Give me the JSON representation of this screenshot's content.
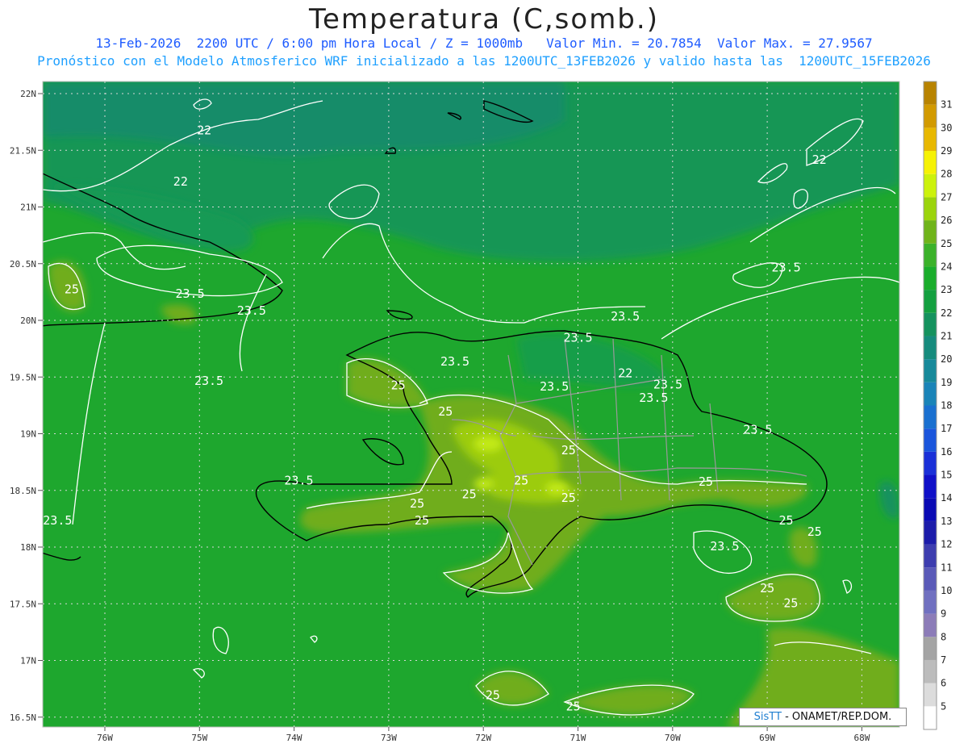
{
  "header": {
    "title": "Temperatura (C,somb.)",
    "line1": "13-Feb-2026  2200 UTC / 6:00 pm Hora Local / Z = 1000mb   Valor Min. = 20.7854  Valor Max. = 27.9567",
    "line2": "Pronóstico con el Modelo Atmosferico WRF inicializado a las 1200UTC_13FEB2026 y valido hasta las  1200UTC_15FEB2026"
  },
  "axes": {
    "lat_labels": [
      "22N",
      "21.5N",
      "21N",
      "20.5N",
      "20N",
      "19.5N",
      "19N",
      "18.5N",
      "18N",
      "17.5N",
      "17N",
      "16.5N"
    ],
    "lon_labels": [
      "76W",
      "75W",
      "74W",
      "73W",
      "72W",
      "71W",
      "70W",
      "69W",
      "68W"
    ]
  },
  "contour_labels": [
    {
      "text": "22",
      "lon": -74.95,
      "lat": 21.64
    },
    {
      "text": "22",
      "lon": -75.2,
      "lat": 21.19
    },
    {
      "text": "22",
      "lon": -68.45,
      "lat": 21.38
    },
    {
      "text": "22",
      "lon": -70.5,
      "lat": 19.5
    },
    {
      "text": "23.5",
      "lon": -75.1,
      "lat": 20.2
    },
    {
      "text": "23.5",
      "lon": -74.45,
      "lat": 20.05
    },
    {
      "text": "23.5",
      "lon": -74.9,
      "lat": 19.43
    },
    {
      "text": "23.5",
      "lon": -71.0,
      "lat": 19.81
    },
    {
      "text": "23.5",
      "lon": -72.3,
      "lat": 19.6
    },
    {
      "text": "23.5",
      "lon": -70.5,
      "lat": 20.0
    },
    {
      "text": "23.5",
      "lon": -71.25,
      "lat": 19.38
    },
    {
      "text": "23.5",
      "lon": -70.05,
      "lat": 19.4
    },
    {
      "text": "23.5",
      "lon": -70.2,
      "lat": 19.28
    },
    {
      "text": "23.5",
      "lon": -69.1,
      "lat": 19.0
    },
    {
      "text": "23.5",
      "lon": -73.95,
      "lat": 18.55
    },
    {
      "text": "23.5",
      "lon": -76.5,
      "lat": 18.2
    },
    {
      "text": "23.5",
      "lon": -69.45,
      "lat": 17.97
    },
    {
      "text": "23.5",
      "lon": -68.8,
      "lat": 20.43
    },
    {
      "text": "25",
      "lon": -76.35,
      "lat": 20.24
    },
    {
      "text": "25",
      "lon": -72.9,
      "lat": 19.39
    },
    {
      "text": "25",
      "lon": -72.4,
      "lat": 19.16
    },
    {
      "text": "25",
      "lon": -71.1,
      "lat": 18.82
    },
    {
      "text": "25",
      "lon": -71.6,
      "lat": 18.55
    },
    {
      "text": "25",
      "lon": -72.7,
      "lat": 18.35
    },
    {
      "text": "25",
      "lon": -72.15,
      "lat": 18.43
    },
    {
      "text": "25",
      "lon": -71.1,
      "lat": 18.4
    },
    {
      "text": "25",
      "lon": -72.65,
      "lat": 18.2
    },
    {
      "text": "25",
      "lon": -69.65,
      "lat": 18.54
    },
    {
      "text": "25",
      "lon": -68.8,
      "lat": 18.2
    },
    {
      "text": "25",
      "lon": -68.5,
      "lat": 18.1
    },
    {
      "text": "25",
      "lon": -69.0,
      "lat": 17.6
    },
    {
      "text": "25",
      "lon": -68.75,
      "lat": 17.47
    },
    {
      "text": "25",
      "lon": -71.9,
      "lat": 16.66
    },
    {
      "text": "25",
      "lon": -71.05,
      "lat": 16.56
    }
  ],
  "colorbar": {
    "labels": [
      "5",
      "6",
      "7",
      "8",
      "9",
      "10",
      "11",
      "12",
      "13",
      "14",
      "15",
      "16",
      "17",
      "18",
      "19",
      "20",
      "21",
      "22",
      "23",
      "24",
      "25",
      "26",
      "27",
      "28",
      "29",
      "30",
      "31"
    ],
    "colors": [
      "#ffffff",
      "#dcdcdc",
      "#bcbcbc",
      "#a4a4a4",
      "#8c7cb8",
      "#7070c0",
      "#5a5ab8",
      "#3d3daf",
      "#1c1caa",
      "#0a0ab4",
      "#1010c8",
      "#1a30d8",
      "#1a55dc",
      "#1a70d0",
      "#1a84b8",
      "#17899a",
      "#168b7d",
      "#15925e",
      "#14a040",
      "#1aad2b",
      "#3bb22a",
      "#6fb41a",
      "#9bd40c",
      "#ccf20c",
      "#f6f205",
      "#e8b800",
      "#d29a00",
      "#b88300"
    ]
  },
  "credit": {
    "brand": "SisTT",
    "text": " - ONAMET/REP.DOM."
  }
}
